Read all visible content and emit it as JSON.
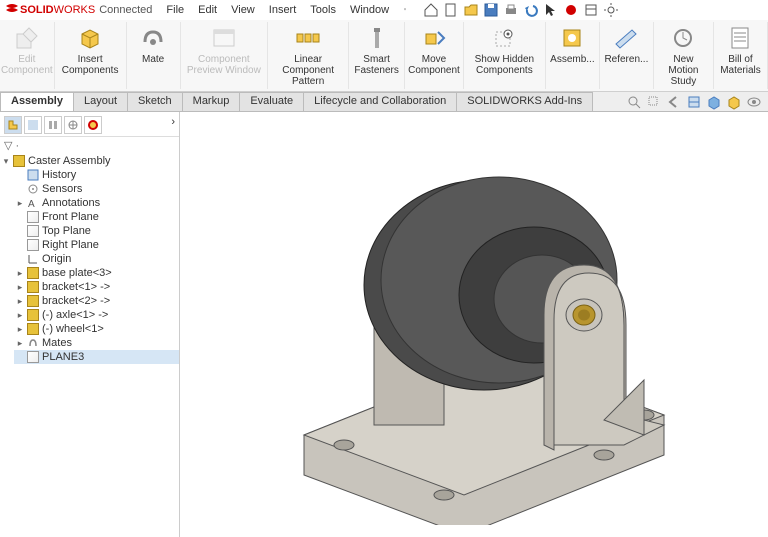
{
  "app": {
    "brand_pre": "SOLID",
    "brand_post": "WORKS",
    "status": "Connected"
  },
  "menubar": [
    "File",
    "Edit",
    "View",
    "Insert",
    "Tools",
    "Window"
  ],
  "ribbon": [
    {
      "label": "Edit Component",
      "disabled": true
    },
    {
      "label": "Insert Components"
    },
    {
      "label": "Mate"
    },
    {
      "label": "Component Preview Window",
      "disabled": true
    },
    {
      "label": "Linear Component Pattern"
    },
    {
      "label": "Smart Fasteners"
    },
    {
      "label": "Move Component"
    },
    {
      "label": "Show Hidden Components"
    },
    {
      "label": "Assemb..."
    },
    {
      "label": "Referen..."
    },
    {
      "label": "New Motion Study"
    },
    {
      "label": "Bill of Materials"
    }
  ],
  "tabs": [
    "Assembly",
    "Layout",
    "Sketch",
    "Markup",
    "Evaluate",
    "Lifecycle and Collaboration",
    "SOLIDWORKS Add-Ins"
  ],
  "active_tab": 0,
  "tree": {
    "root": "Caster Assembly",
    "root_sub": [
      "History",
      "Sensors",
      "Annotations",
      "Front Plane",
      "Top Plane",
      "Right Plane",
      "Origin"
    ],
    "components": [
      "base plate<3>",
      "bracket<1> ->",
      "bracket<2> ->",
      "(-) axle<1> ->",
      "(-) wheel<1>"
    ],
    "tail": [
      "Mates",
      "PLANE3"
    ]
  }
}
